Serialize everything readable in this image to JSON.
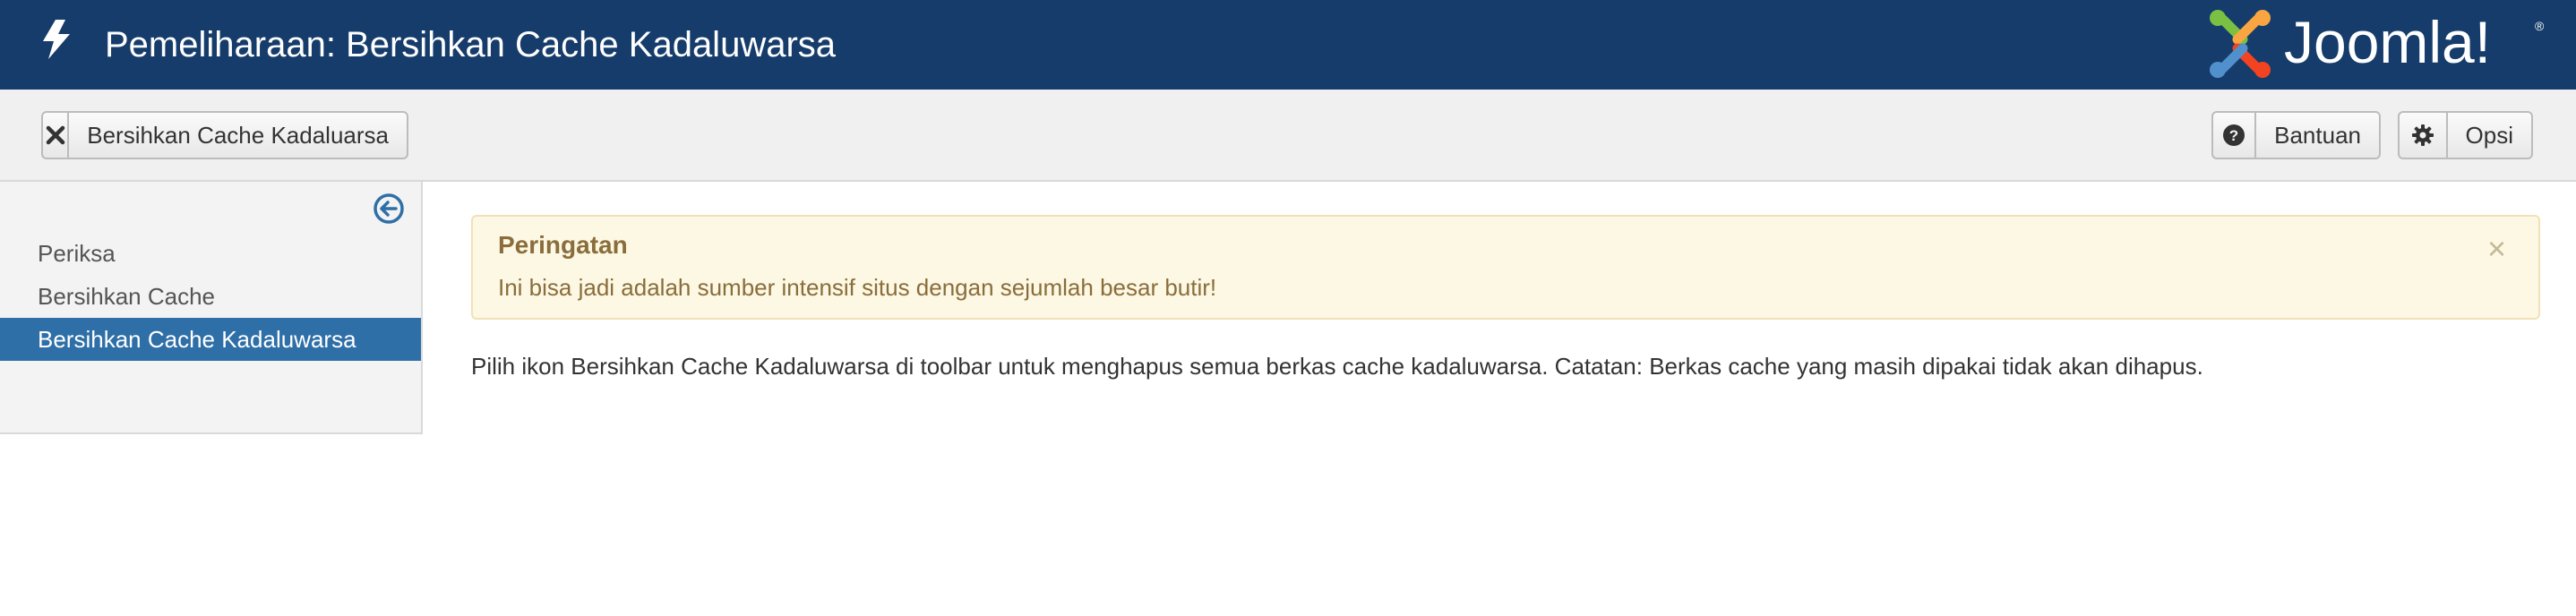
{
  "header": {
    "title": "Pemeliharaan: Bersihkan Cache Kadaluwarsa",
    "background_color": "#163c6b",
    "page_icon": "lightning-bolt-icon",
    "brand": {
      "name": "Joomla!",
      "wordmark_text": "Joomla!",
      "logo_colors": [
        "#7ac143",
        "#f9a541",
        "#f44321",
        "#5091cd"
      ]
    }
  },
  "toolbar": {
    "purge_button": {
      "label": "Bersihkan Cache Kadaluarsa",
      "icon": "close-icon"
    },
    "help_button": {
      "label": "Bantuan",
      "icon": "question-circle-icon"
    },
    "options_button": {
      "label": "Opsi",
      "icon": "gear-icon"
    }
  },
  "sidebar": {
    "toggle_icon": "collapse-left-arrow-icon",
    "items": [
      {
        "label": "Periksa",
        "active": false
      },
      {
        "label": "Bersihkan Cache",
        "active": false
      },
      {
        "label": "Bersihkan Cache Kadaluwarsa",
        "active": true
      }
    ],
    "active_color": "#2f6fa7"
  },
  "main": {
    "alert": {
      "heading": "Peringatan",
      "message": "Ini bisa jadi adalah sumber intensif situs dengan sejumlah besar butir!",
      "close_label": "×",
      "color": "#8a6d3b",
      "background": "#fcf8e3"
    },
    "description": "Pilih ikon Bersihkan Cache Kadaluwarsa di toolbar untuk menghapus semua berkas cache kadaluwarsa. Catatan: Berkas cache yang masih dipakai tidak akan dihapus."
  }
}
